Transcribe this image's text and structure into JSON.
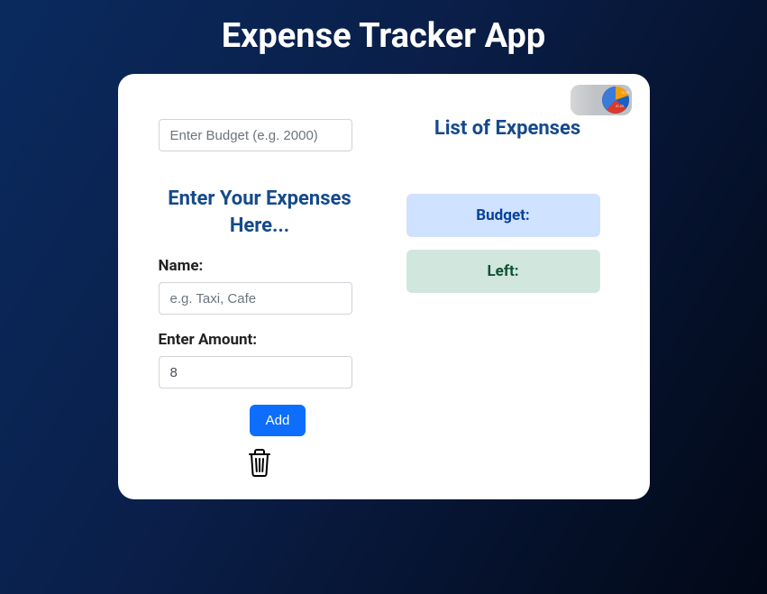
{
  "app": {
    "title": "Expense Tracker App"
  },
  "budget_input": {
    "placeholder": "Enter Budget (e.g. 2000)",
    "value": ""
  },
  "expenses_form": {
    "heading": "Enter Your Expenses Here...",
    "name_label": "Name:",
    "name_placeholder": "e.g. Taxi, Cafe",
    "name_value": "",
    "amount_label": "Enter Amount:",
    "amount_value": "8",
    "add_label": "Add"
  },
  "summary": {
    "list_heading": "List of Expenses",
    "budget_label": "Budget:",
    "left_label": "Left:"
  }
}
